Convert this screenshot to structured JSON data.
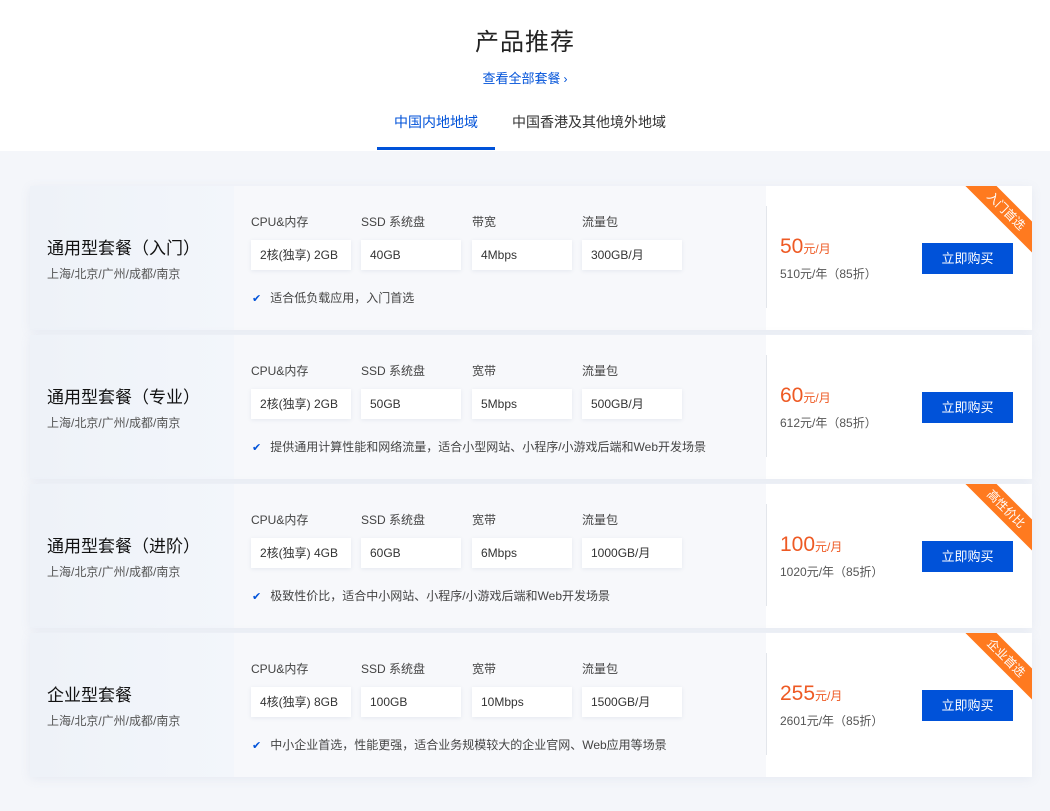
{
  "header": {
    "title": "产品推荐",
    "view_all": "查看全部套餐",
    "tabs": [
      {
        "label": "中国内地地域",
        "active": true
      },
      {
        "label": "中国香港及其他境外地域",
        "active": false
      }
    ]
  },
  "colors": {
    "accent": "#0052d9",
    "price": "#ee5a24",
    "ribbon": "#ff7a1f"
  },
  "plans": [
    {
      "name": "通用型套餐（入门）",
      "regions": "上海/北京/广州/成都/南京",
      "specs": [
        {
          "label": "CPU&内存",
          "value": "2核(独享) 2GB"
        },
        {
          "label": "SSD 系统盘",
          "value": "40GB"
        },
        {
          "label": "带宽",
          "value": "4Mbps"
        },
        {
          "label": "流量包",
          "value": "300GB/月"
        }
      ],
      "feature": "适合低负载应用，入门首选",
      "price": "50",
      "price_unit": "元/月",
      "yearly": "510元/年（85折）",
      "buy_label": "立即购买",
      "ribbon": "入门首选"
    },
    {
      "name": "通用型套餐（专业）",
      "regions": "上海/北京/广州/成都/南京",
      "specs": [
        {
          "label": "CPU&内存",
          "value": "2核(独享) 2GB"
        },
        {
          "label": "SSD 系统盘",
          "value": "50GB"
        },
        {
          "label": "宽带",
          "value": "5Mbps"
        },
        {
          "label": "流量包",
          "value": "500GB/月"
        }
      ],
      "feature": "提供通用计算性能和网络流量，适合小型网站、小程序/小游戏后端和Web开发场景",
      "price": "60",
      "price_unit": "元/月",
      "yearly": "612元/年（85折）",
      "buy_label": "立即购买",
      "ribbon": ""
    },
    {
      "name": "通用型套餐（进阶）",
      "regions": "上海/北京/广州/成都/南京",
      "specs": [
        {
          "label": "CPU&内存",
          "value": "2核(独享) 4GB"
        },
        {
          "label": "SSD 系统盘",
          "value": "60GB"
        },
        {
          "label": "宽带",
          "value": "6Mbps"
        },
        {
          "label": "流量包",
          "value": "1000GB/月"
        }
      ],
      "feature": "极致性价比，适合中小网站、小程序/小游戏后端和Web开发场景",
      "price": "100",
      "price_unit": "元/月",
      "yearly": "1020元/年（85折）",
      "buy_label": "立即购买",
      "ribbon": "高性价比"
    },
    {
      "name": "企业型套餐",
      "regions": "上海/北京/广州/成都/南京",
      "specs": [
        {
          "label": "CPU&内存",
          "value": "4核(独享) 8GB"
        },
        {
          "label": "SSD 系统盘",
          "value": "100GB"
        },
        {
          "label": "宽带",
          "value": "10Mbps"
        },
        {
          "label": "流量包",
          "value": "1500GB/月"
        }
      ],
      "feature": "中小企业首选，性能更强，适合业务规模较大的企业官网、Web应用等场景",
      "price": "255",
      "price_unit": "元/月",
      "yearly": "2601元/年（85折）",
      "buy_label": "立即购买",
      "ribbon": "企业首选"
    }
  ]
}
